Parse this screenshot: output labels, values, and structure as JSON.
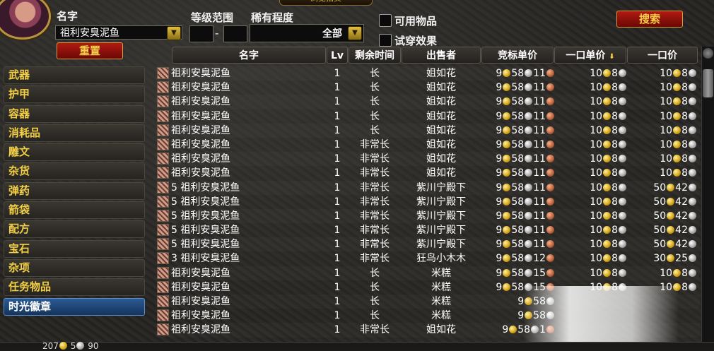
{
  "window": {
    "title": "浏览拍卖"
  },
  "filters": {
    "name_label": "名字",
    "name_value": "祖利安臭泥鱼",
    "level_label": "等级范围",
    "level_sep": "-",
    "rarity_label": "稀有程度",
    "rarity_value": "全部",
    "usable_label": "可用物品",
    "preview_label": "试穿效果",
    "search_button": "搜索",
    "reset_button": "重置"
  },
  "categories": [
    "武器",
    "护甲",
    "容器",
    "消耗品",
    "雕文",
    "杂货",
    "弹药",
    "箭袋",
    "配方",
    "宝石",
    "杂项",
    "任务物品",
    "时光徽章"
  ],
  "selected_category": "时光徽章",
  "columns": {
    "name": "名字",
    "lv": "Lv",
    "time": "剩余时间",
    "seller": "出售者",
    "bid": "竞标单价",
    "buyout_unit": "一口单价",
    "buyout": "一口价"
  },
  "rows": [
    {
      "name": "祖利安臭泥鱼",
      "lv": "1",
      "time": "长",
      "seller": "姐如花",
      "bid": [
        "9",
        "58",
        "11"
      ],
      "unit": [
        "10",
        "8"
      ],
      "buyout": [
        "10",
        "8"
      ]
    },
    {
      "name": "祖利安臭泥鱼",
      "lv": "1",
      "time": "长",
      "seller": "姐如花",
      "bid": [
        "9",
        "58",
        "11"
      ],
      "unit": [
        "10",
        "8"
      ],
      "buyout": [
        "10",
        "8"
      ]
    },
    {
      "name": "祖利安臭泥鱼",
      "lv": "1",
      "time": "长",
      "seller": "姐如花",
      "bid": [
        "9",
        "58",
        "11"
      ],
      "unit": [
        "10",
        "8"
      ],
      "buyout": [
        "10",
        "8"
      ]
    },
    {
      "name": "祖利安臭泥鱼",
      "lv": "1",
      "time": "长",
      "seller": "姐如花",
      "bid": [
        "9",
        "58",
        "11"
      ],
      "unit": [
        "10",
        "8"
      ],
      "buyout": [
        "10",
        "8"
      ]
    },
    {
      "name": "祖利安臭泥鱼",
      "lv": "1",
      "time": "长",
      "seller": "姐如花",
      "bid": [
        "9",
        "58",
        "11"
      ],
      "unit": [
        "10",
        "8"
      ],
      "buyout": [
        "10",
        "8"
      ]
    },
    {
      "name": "祖利安臭泥鱼",
      "lv": "1",
      "time": "非常长",
      "seller": "姐如花",
      "bid": [
        "9",
        "58",
        "11"
      ],
      "unit": [
        "10",
        "8"
      ],
      "buyout": [
        "10",
        "8"
      ]
    },
    {
      "name": "祖利安臭泥鱼",
      "lv": "1",
      "time": "非常长",
      "seller": "姐如花",
      "bid": [
        "9",
        "58",
        "11"
      ],
      "unit": [
        "10",
        "8"
      ],
      "buyout": [
        "10",
        "8"
      ]
    },
    {
      "name": "祖利安臭泥鱼",
      "lv": "1",
      "time": "非常长",
      "seller": "姐如花",
      "bid": [
        "9",
        "58",
        "11"
      ],
      "unit": [
        "10",
        "8"
      ],
      "buyout": [
        "10",
        "8"
      ]
    },
    {
      "name": "5 祖利安臭泥鱼",
      "lv": "1",
      "time": "非常长",
      "seller": "紫川宁殿下",
      "bid": [
        "9",
        "58",
        "11"
      ],
      "unit": [
        "10",
        "8"
      ],
      "buyout": [
        "50",
        "42"
      ]
    },
    {
      "name": "5 祖利安臭泥鱼",
      "lv": "1",
      "time": "非常长",
      "seller": "紫川宁殿下",
      "bid": [
        "9",
        "58",
        "11"
      ],
      "unit": [
        "10",
        "8"
      ],
      "buyout": [
        "50",
        "42"
      ]
    },
    {
      "name": "5 祖利安臭泥鱼",
      "lv": "1",
      "time": "非常长",
      "seller": "紫川宁殿下",
      "bid": [
        "9",
        "58",
        "11"
      ],
      "unit": [
        "10",
        "8"
      ],
      "buyout": [
        "50",
        "42"
      ]
    },
    {
      "name": "5 祖利安臭泥鱼",
      "lv": "1",
      "time": "非常长",
      "seller": "紫川宁殿下",
      "bid": [
        "9",
        "58",
        "11"
      ],
      "unit": [
        "10",
        "8"
      ],
      "buyout": [
        "50",
        "42"
      ]
    },
    {
      "name": "5 祖利安臭泥鱼",
      "lv": "1",
      "time": "非常长",
      "seller": "紫川宁殿下",
      "bid": [
        "9",
        "58",
        "11"
      ],
      "unit": [
        "10",
        "8"
      ],
      "buyout": [
        "50",
        "42"
      ]
    },
    {
      "name": "3 祖利安臭泥鱼",
      "lv": "1",
      "time": "非常长",
      "seller": "狂鸟小木木",
      "bid": [
        "9",
        "58",
        "12"
      ],
      "unit": [
        "10",
        "8"
      ],
      "buyout": [
        "30",
        "25"
      ]
    },
    {
      "name": "祖利安臭泥鱼",
      "lv": "1",
      "time": "长",
      "seller": "米糕",
      "bid": [
        "9",
        "58",
        "15"
      ],
      "unit": [
        "10",
        "8"
      ],
      "buyout": [
        "10",
        "8"
      ]
    },
    {
      "name": "祖利安臭泥鱼",
      "lv": "1",
      "time": "长",
      "seller": "米糕",
      "bid": [
        "9",
        "58",
        "15"
      ],
      "unit": [
        "10",
        "8"
      ],
      "buyout": [
        "10",
        "8"
      ]
    },
    {
      "name": "祖利安臭泥鱼",
      "lv": "1",
      "time": "长",
      "seller": "米糕",
      "bid": [
        "9",
        "58",
        ""
      ],
      "unit": [
        "",
        ""
      ],
      "buyout": [
        "",
        ""
      ]
    },
    {
      "name": "祖利安臭泥鱼",
      "lv": "1",
      "time": "长",
      "seller": "米糕",
      "bid": [
        "9",
        "58",
        ""
      ],
      "unit": [
        "",
        ""
      ],
      "buyout": [
        "",
        ""
      ]
    },
    {
      "name": "祖利安臭泥鱼",
      "lv": "1",
      "time": "非常长",
      "seller": "姐如花",
      "bid": [
        "9",
        "58",
        "1"
      ],
      "unit": [
        "",
        ""
      ],
      "buyout": [
        "",
        ""
      ]
    }
  ],
  "player_money": {
    "gold": "207",
    "silver": "5",
    "copper": "90"
  }
}
